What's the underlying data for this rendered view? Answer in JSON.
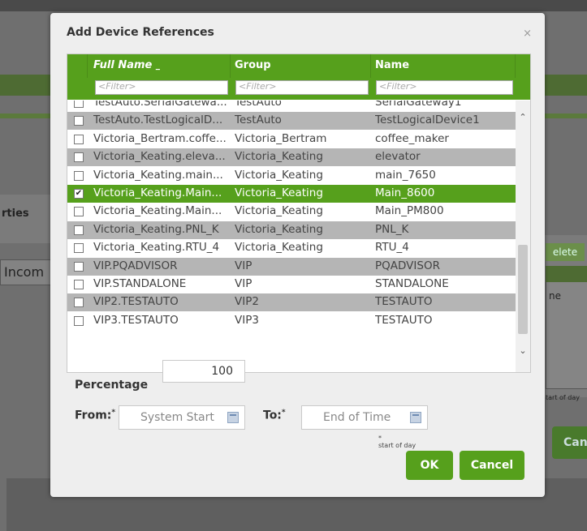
{
  "background": {
    "properties_label": "rties",
    "income_field": "Incom",
    "delete_button": "elete",
    "right_list_text": "ne",
    "start_of_day": "tart of day",
    "cancel_button_partial": "Can"
  },
  "modal": {
    "title": "Add Device References",
    "close_label": "×",
    "columns": [
      {
        "label": "Full Name",
        "sort_indicator": "_",
        "filter_placeholder": "<Filter>"
      },
      {
        "label": "Group",
        "filter_placeholder": "<Filter>"
      },
      {
        "label": "Name",
        "filter_placeholder": "<Filter>"
      }
    ],
    "rows": [
      {
        "checked": false,
        "full_name": "TestAuto.SerialGatewa...",
        "group": "TestAuto",
        "name": "SerialGateway1",
        "style": "white"
      },
      {
        "checked": false,
        "full_name": "TestAuto.TestLogicalD...",
        "group": "TestAuto",
        "name": "TestLogicalDevice1",
        "style": "gray"
      },
      {
        "checked": false,
        "full_name": "Victoria_Bertram.coffe...",
        "group": "Victoria_Bertram",
        "name": "coffee_maker",
        "style": "white"
      },
      {
        "checked": false,
        "full_name": "Victoria_Keating.eleva...",
        "group": "Victoria_Keating",
        "name": "elevator",
        "style": "gray"
      },
      {
        "checked": false,
        "full_name": "Victoria_Keating.main...",
        "group": "Victoria_Keating",
        "name": "main_7650",
        "style": "white"
      },
      {
        "checked": true,
        "full_name": "Victoria_Keating.Main...",
        "group": "Victoria_Keating",
        "name": "Main_8600",
        "style": "sel"
      },
      {
        "checked": false,
        "full_name": "Victoria_Keating.Main...",
        "group": "Victoria_Keating",
        "name": "Main_PM800",
        "style": "white"
      },
      {
        "checked": false,
        "full_name": "Victoria_Keating.PNL_K",
        "group": "Victoria_Keating",
        "name": "PNL_K",
        "style": "gray"
      },
      {
        "checked": false,
        "full_name": "Victoria_Keating.RTU_4",
        "group": "Victoria_Keating",
        "name": "RTU_4",
        "style": "white"
      },
      {
        "checked": false,
        "full_name": "VIP.PQADVISOR",
        "group": "VIP",
        "name": "PQADVISOR",
        "style": "gray"
      },
      {
        "checked": false,
        "full_name": "VIP.STANDALONE",
        "group": "VIP",
        "name": "STANDALONE",
        "style": "white"
      },
      {
        "checked": false,
        "full_name": "VIP2.TESTAUTO",
        "group": "VIP2",
        "name": "TESTAUTO",
        "style": "gray"
      },
      {
        "checked": false,
        "full_name": "VIP3.TESTAUTO",
        "group": "VIP3",
        "name": "TESTAUTO",
        "style": "white"
      }
    ],
    "percentage_label": "Percentage",
    "percentage_value": "100",
    "from_label": "From:",
    "from_required": "*",
    "from_value": "System Start",
    "to_label": "To:",
    "to_required": "*",
    "to_value": "End of Time",
    "start_of_day_note": "start of day",
    "ok_button": "OK",
    "cancel_button": "Cancel"
  },
  "colors": {
    "accent_green": "#56a01c",
    "row_gray": "#b5b5b5"
  }
}
